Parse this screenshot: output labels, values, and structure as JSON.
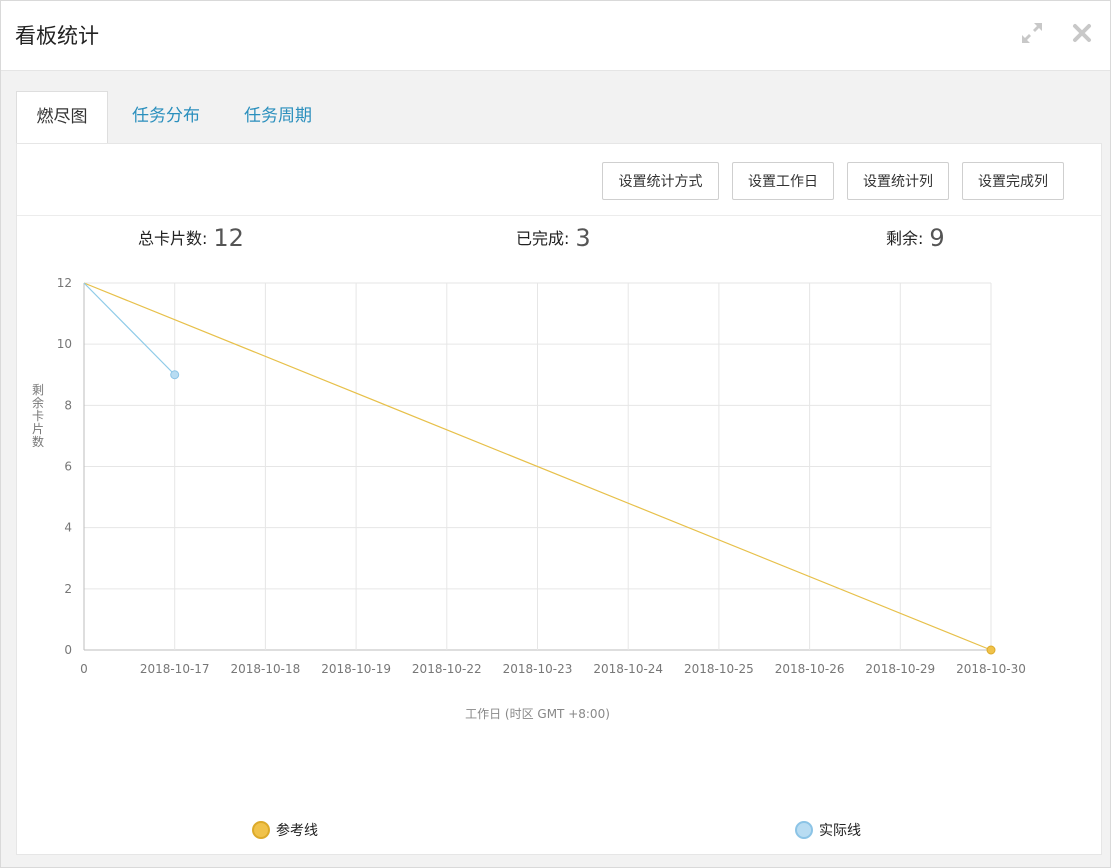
{
  "dialog": {
    "title": "看板统计",
    "expand_icon": "expand-icon",
    "close_icon": "close-icon"
  },
  "tabs": [
    {
      "label": "燃尽图",
      "active": true
    },
    {
      "label": "任务分布",
      "active": false
    },
    {
      "label": "任务周期",
      "active": false
    }
  ],
  "toolbar": {
    "buttons": [
      "设置统计方式",
      "设置工作日",
      "设置统计列",
      "设置完成列"
    ]
  },
  "stats": [
    {
      "label": "总卡片数:",
      "value": "12"
    },
    {
      "label": "已完成:",
      "value": "3"
    },
    {
      "label": "剩余:",
      "value": "9"
    }
  ],
  "chart_data": {
    "type": "line",
    "ylabel": "剩余卡片数",
    "xlabel": "工作日 (时区 GMT +8:00)",
    "categories": [
      "0",
      "2018-10-17",
      "2018-10-18",
      "2018-10-19",
      "2018-10-22",
      "2018-10-23",
      "2018-10-24",
      "2018-10-25",
      "2018-10-26",
      "2018-10-29",
      "2018-10-30"
    ],
    "ylim": [
      0,
      12
    ],
    "yticks": [
      0,
      2,
      4,
      6,
      8,
      10,
      12
    ],
    "grid": true,
    "legend_position": "bottom",
    "series": [
      {
        "name": "参考线",
        "color": "#e7c04a",
        "fill": "#f0c24a",
        "stroke": "#dcaa2a",
        "points": [
          [
            0,
            12
          ],
          [
            10,
            0
          ]
        ]
      },
      {
        "name": "实际线",
        "color": "#8fcbe8",
        "fill": "#b8dcf2",
        "stroke": "#8cc4e6",
        "points": [
          [
            0,
            12
          ],
          [
            1,
            9
          ]
        ]
      }
    ]
  }
}
